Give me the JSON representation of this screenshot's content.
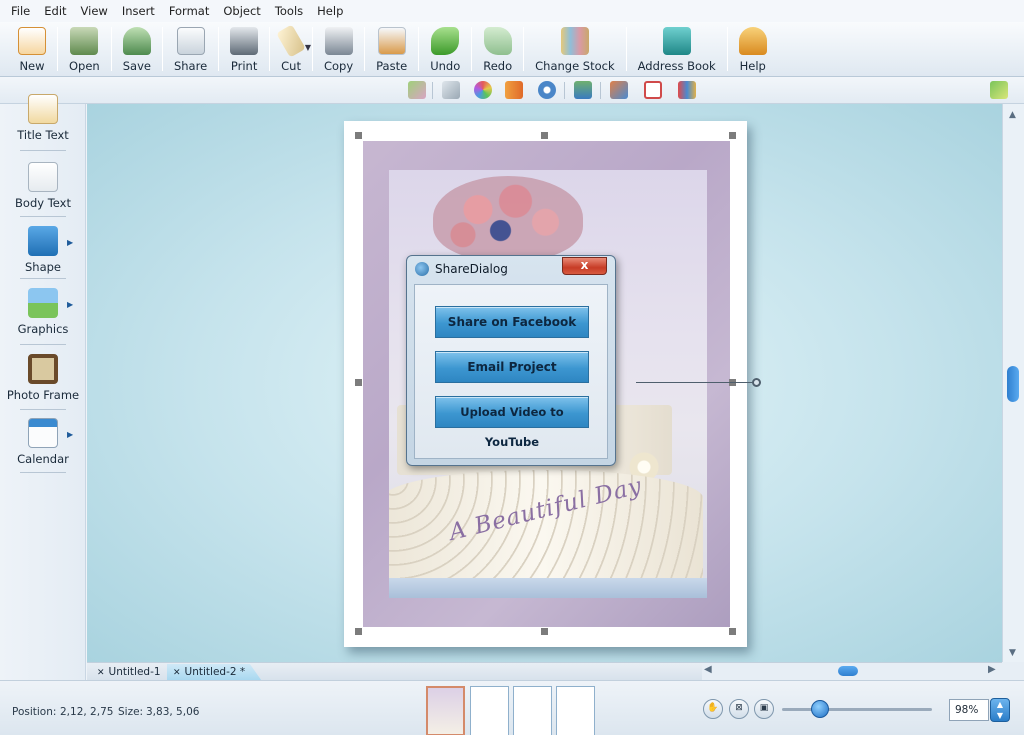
{
  "menu": [
    "File",
    "Edit",
    "View",
    "Insert",
    "Format",
    "Object",
    "Tools",
    "Help"
  ],
  "toolbar": {
    "buttons": [
      {
        "label": "New",
        "icon": "new-document-icon",
        "color": "#f2a33a"
      },
      {
        "label": "Open",
        "icon": "open-icon",
        "color": "#6b8b5a"
      },
      {
        "label": "Save",
        "icon": "save-icon",
        "color": "#4e8a4e"
      },
      {
        "label": "Share",
        "icon": "share-icon",
        "color": "#8e9aa6"
      },
      {
        "label": "Print",
        "icon": "printer-icon",
        "color": "#5e6a76"
      },
      {
        "label": "Cut",
        "icon": "cut-icon",
        "color": "#d7c18a"
      },
      {
        "label": "Copy",
        "icon": "copy-icon",
        "color": "#7b8794"
      },
      {
        "label": "Paste",
        "icon": "paste-icon",
        "color": "#d99a4a"
      },
      {
        "label": "Undo",
        "icon": "undo-icon",
        "color": "#4ea83a"
      },
      {
        "label": "Redo",
        "icon": "redo-icon",
        "color": "#8fbf8f"
      },
      {
        "label": "Change Stock",
        "icon": "change-stock-icon",
        "color": "#c9a86b"
      },
      {
        "label": "Address Book",
        "icon": "address-book-icon",
        "color": "#2a9a9a"
      },
      {
        "label": "Help",
        "icon": "help-icon",
        "color": "#e0a030"
      }
    ]
  },
  "format_toolbar": {
    "icons": [
      "pencil-icon",
      "eyedropper-icon",
      "color-wheel-icon",
      "align-icon",
      "effects-icon",
      "arrange-icon",
      "group-icon",
      "crop-icon",
      "flip-icon",
      "layout-icon"
    ]
  },
  "sidebar": {
    "items": [
      {
        "label": "Title Text",
        "icon": "title-text-icon",
        "has_menu": false
      },
      {
        "label": "Body Text",
        "icon": "body-text-icon",
        "has_menu": false
      },
      {
        "label": "Shape",
        "icon": "shape-icon",
        "has_menu": true
      },
      {
        "label": "Graphics",
        "icon": "graphics-icon",
        "has_menu": true
      },
      {
        "label": "Photo Frame",
        "icon": "photo-frame-icon",
        "has_menu": false
      },
      {
        "label": "Calendar",
        "icon": "calendar-icon",
        "has_menu": true
      }
    ]
  },
  "card": {
    "script_text": "A Beautiful Day"
  },
  "dialog": {
    "title": "ShareDialog",
    "close_label": "x",
    "buttons": [
      "Share on Facebook",
      "Email Project",
      "Upload Video to YouTube"
    ]
  },
  "tabs": [
    {
      "label": "Untitled-1",
      "active": false
    },
    {
      "label": "Untitled-2 *",
      "active": true
    }
  ],
  "status": {
    "position_label": "Position:",
    "position_value": "2,12, 2,75",
    "size_label": "Size:",
    "size_value": "3,83, 5,06",
    "zoom": "98%",
    "page_thumbnails": 4
  },
  "colors": {
    "accent": "#2f7fcf",
    "dialog_button": "#3c96d0",
    "close_button": "#c73c26"
  }
}
